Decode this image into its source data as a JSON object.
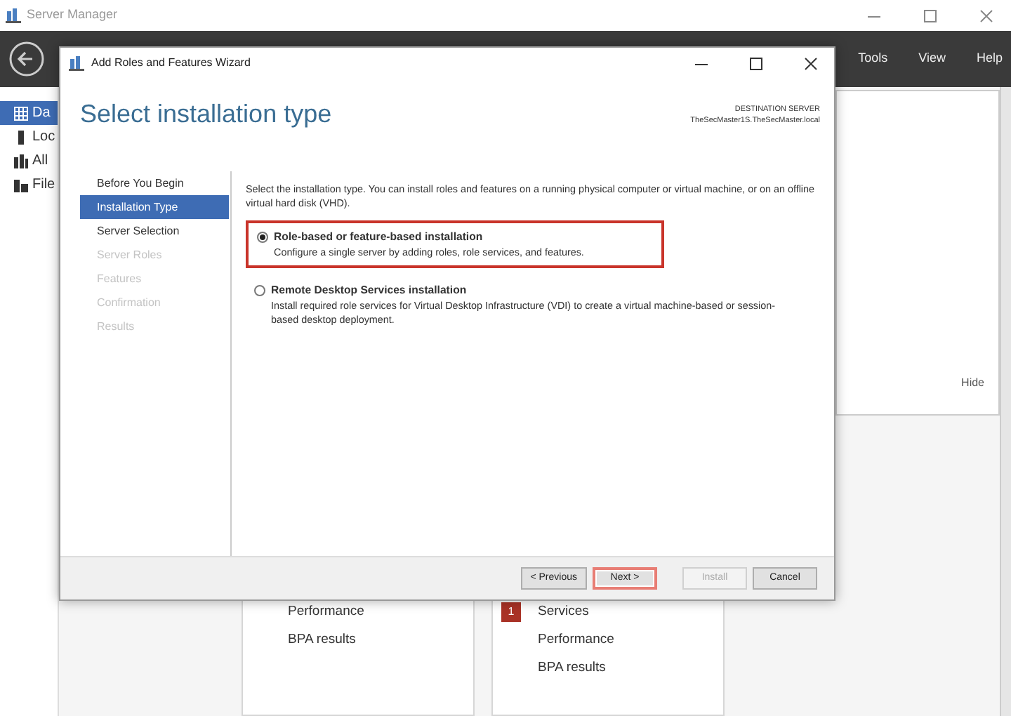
{
  "app_window": {
    "title": "Server Manager",
    "menu": [
      "Tools",
      "View",
      "Help"
    ],
    "sidebar": [
      {
        "label": "Da",
        "selected": true,
        "kind": "dashboard"
      },
      {
        "label": "Loc",
        "selected": false,
        "kind": "server"
      },
      {
        "label": "All",
        "selected": false,
        "kind": "servers"
      },
      {
        "label": "File",
        "selected": false,
        "kind": "files"
      }
    ],
    "hide_link": "Hide",
    "tiles": [
      {
        "rows": [
          {
            "label": "Performance"
          },
          {
            "label": "BPA results"
          }
        ]
      },
      {
        "rows": [
          {
            "label": "Services",
            "count": "1"
          },
          {
            "label": "Performance"
          },
          {
            "label": "BPA results"
          }
        ]
      }
    ]
  },
  "wizard": {
    "title": "Add Roles and Features Wizard",
    "heading": "Select installation type",
    "destination_label": "DESTINATION SERVER",
    "destination_server": "TheSecMaster1S.TheSecMaster.local",
    "steps": [
      {
        "label": "Before You Begin",
        "selected": false,
        "disabled": false
      },
      {
        "label": "Installation Type",
        "selected": true,
        "disabled": false
      },
      {
        "label": "Server Selection",
        "selected": false,
        "disabled": false
      },
      {
        "label": "Server Roles",
        "selected": false,
        "disabled": true
      },
      {
        "label": "Features",
        "selected": false,
        "disabled": true
      },
      {
        "label": "Confirmation",
        "selected": false,
        "disabled": true
      },
      {
        "label": "Results",
        "selected": false,
        "disabled": true
      }
    ],
    "intro": "Select the installation type. You can install roles and features on a running physical computer or virtual machine, or on an offline virtual hard disk (VHD).",
    "options": [
      {
        "label": "Role-based or feature-based installation",
        "description": "Configure a single server by adding roles, role services, and features.",
        "selected": true,
        "highlighted": true
      },
      {
        "label": "Remote Desktop Services installation",
        "description": "Install required role services for Virtual Desktop Infrastructure (VDI) to create a virtual machine-based or session-based desktop deployment.",
        "selected": false,
        "highlighted": false
      }
    ],
    "buttons": [
      {
        "label": "< Previous",
        "disabled": false,
        "highlighted": false
      },
      {
        "label": "Next >",
        "disabled": false,
        "highlighted": true
      },
      {
        "label": "Install",
        "disabled": true,
        "highlighted": false
      },
      {
        "label": "Cancel",
        "disabled": false,
        "highlighted": false
      }
    ]
  }
}
